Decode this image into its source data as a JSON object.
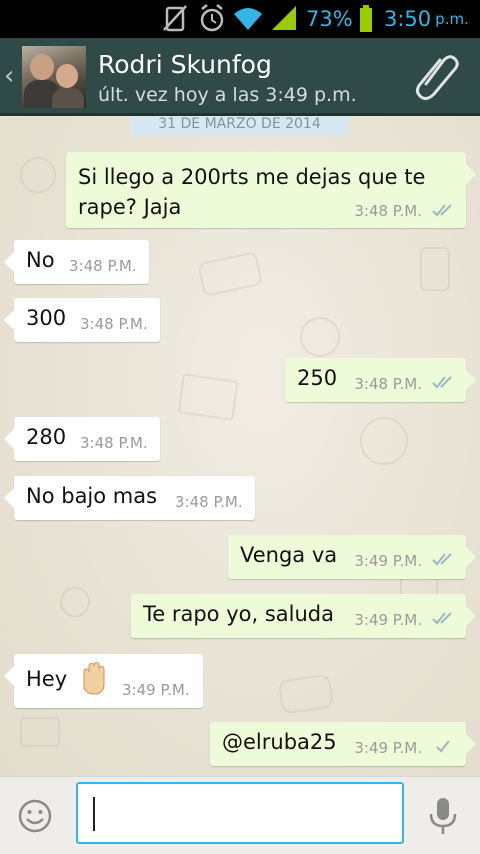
{
  "status_bar": {
    "battery_percent": "73%",
    "time": "3:50",
    "time_suffix": "p.m.",
    "accent_color": "#33b5e5",
    "icons": [
      "no-sim-icon",
      "alarm-icon",
      "wifi-icon",
      "signal-icon",
      "battery-icon"
    ]
  },
  "header": {
    "contact_name": "Rodri Skunfog",
    "last_seen": "últ. vez hoy a las 3:49 p.m.",
    "icons": [
      "back-chevron-icon",
      "avatar",
      "paperclip-icon"
    ],
    "bar_color": "#2f4a47"
  },
  "chat": {
    "date_label": "31 DE MARZO DE 2014",
    "messages": [
      {
        "direction": "out",
        "text": "Si llego a 200rts me dejas que te rape? Jaja",
        "time": "3:48 P.M.",
        "status": "read"
      },
      {
        "direction": "in",
        "text": "No",
        "time": "3:48 P.M."
      },
      {
        "direction": "in",
        "text": "300",
        "time": "3:48 P.M."
      },
      {
        "direction": "out",
        "text": "250",
        "time": "3:48 P.M.",
        "status": "read"
      },
      {
        "direction": "in",
        "text": "280",
        "time": "3:48 P.M."
      },
      {
        "direction": "in",
        "text": "No bajo mas",
        "time": "3:48 P.M."
      },
      {
        "direction": "out",
        "text": "Venga va",
        "time": "3:49 P.M.",
        "status": "read"
      },
      {
        "direction": "out",
        "text": "Te rapo yo, saluda",
        "time": "3:49 P.M.",
        "status": "read"
      },
      {
        "direction": "in",
        "text": "Hey",
        "time": "3:49 P.M.",
        "emoji": "raised-hand-icon"
      },
      {
        "direction": "out",
        "text": "@elruba25",
        "time": "3:49 P.M.",
        "status": "sent"
      }
    ],
    "outgoing_bubble_color": "#eefbd9",
    "incoming_bubble_color": "#ffffff"
  },
  "composer": {
    "value": "",
    "placeholder": "",
    "icons": [
      "emoji-icon",
      "mic-icon"
    ]
  }
}
